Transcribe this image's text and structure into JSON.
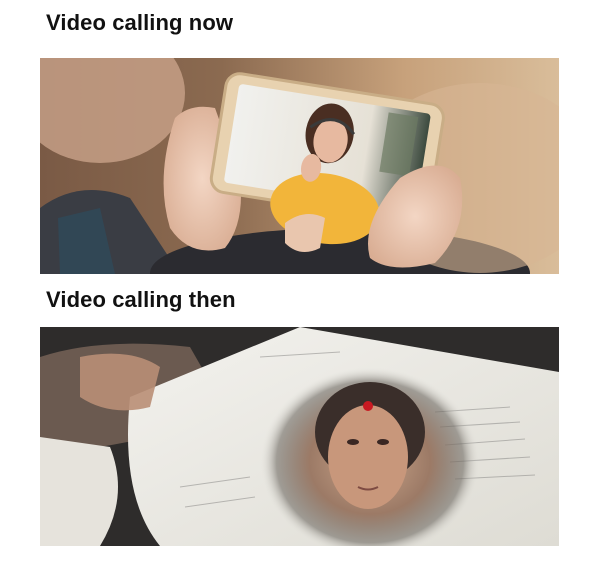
{
  "captions": {
    "top": "Video calling now",
    "bottom": "Video calling then"
  },
  "panels": {
    "top": {
      "image": "hands-holding-smartphone-video-call-photo"
    },
    "bottom": {
      "image": "hand-holding-handwritten-letter-with-portrait-photo"
    }
  },
  "colors": {
    "background": "#ffffff",
    "caption_text": "#111111",
    "shirt_yellow": "#f2b53a",
    "bindi_red": "#c81a22"
  }
}
